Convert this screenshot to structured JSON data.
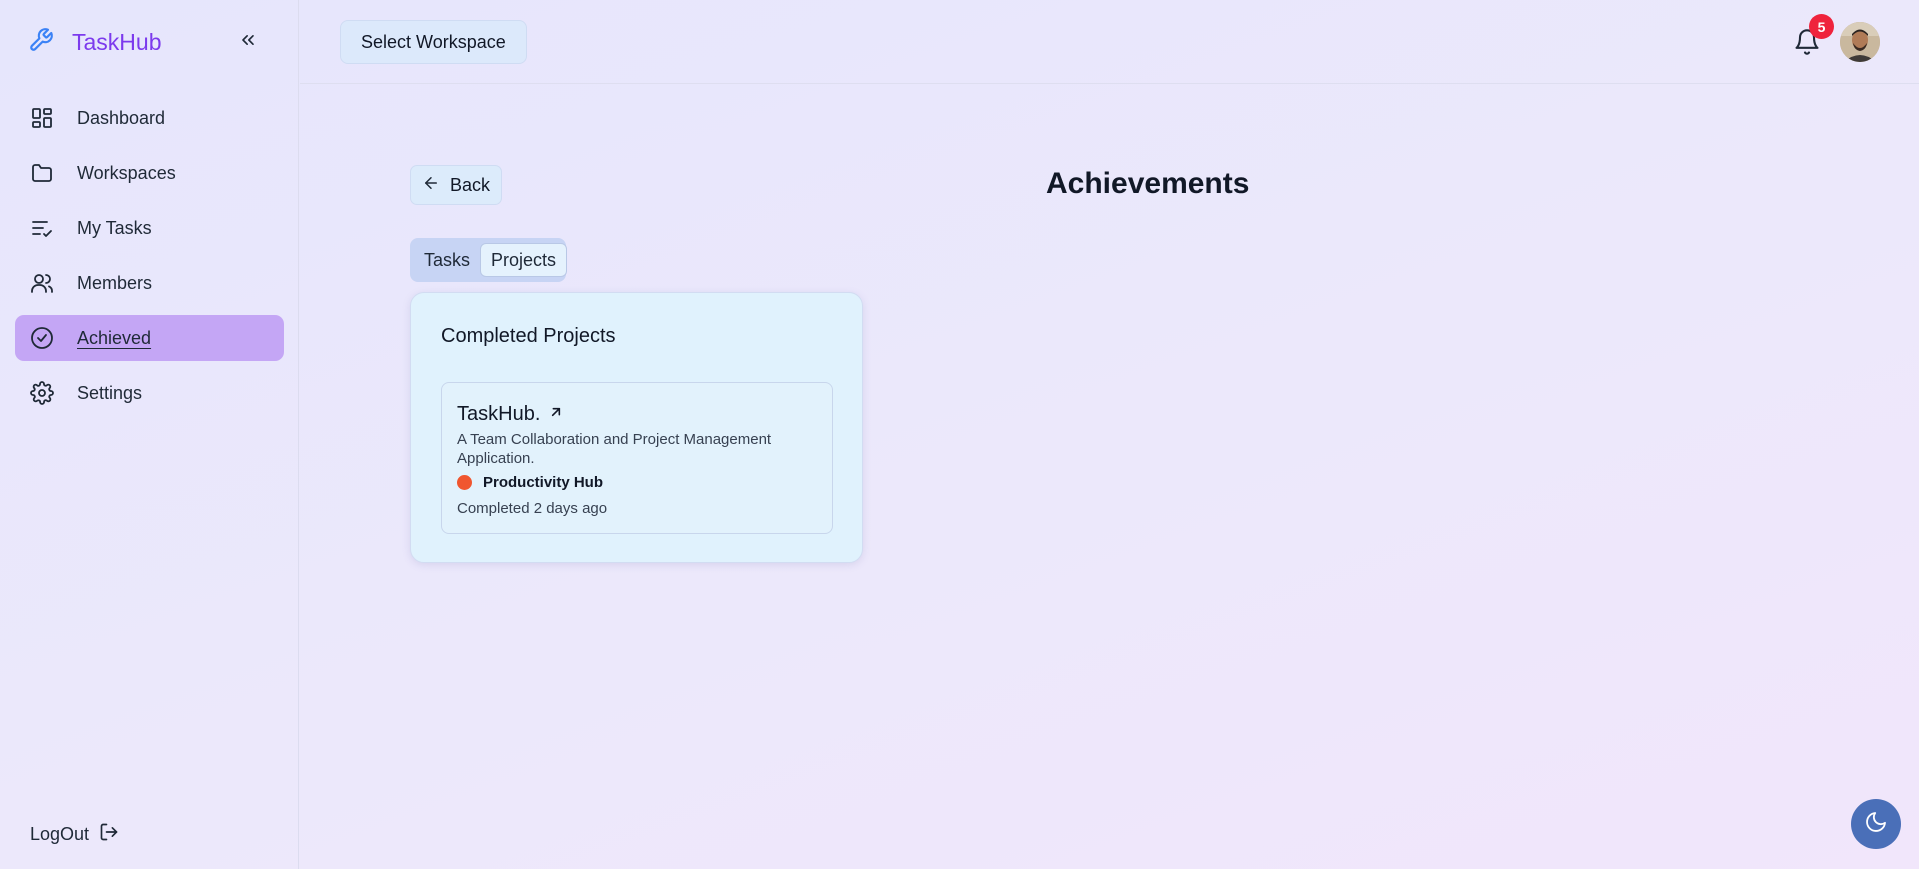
{
  "brand": {
    "name": "TaskHub",
    "icon": "wrench-icon",
    "accent": "#7c3aed"
  },
  "sidebar": {
    "collapse_icon": "chevrons-left-icon",
    "items": [
      {
        "label": "Dashboard",
        "icon": "layout-dashboard-icon"
      },
      {
        "label": "Workspaces",
        "icon": "folder-icon"
      },
      {
        "label": "My Tasks",
        "icon": "list-check-icon"
      },
      {
        "label": "Members",
        "icon": "users-icon"
      },
      {
        "label": "Achieved",
        "icon": "check-circle-icon",
        "active": true
      },
      {
        "label": "Settings",
        "icon": "gear-icon"
      }
    ],
    "logout_label": "LogOut"
  },
  "header": {
    "workspace_button": "Select Workspace",
    "notification_count": "5"
  },
  "main": {
    "back_label": "Back",
    "title": "Achievements",
    "tabs": [
      {
        "label": "Tasks",
        "active": false
      },
      {
        "label": "Projects",
        "active": true
      }
    ],
    "card": {
      "title": "Completed Projects",
      "projects": [
        {
          "name": "TaskHub.",
          "description": "A Team Collaboration and Project Management Application.",
          "workspace": "Productivity Hub",
          "workspace_color": "#f0562f",
          "completed": "Completed 2 days ago"
        }
      ]
    }
  },
  "theme_toggle_icon": "moon-icon"
}
